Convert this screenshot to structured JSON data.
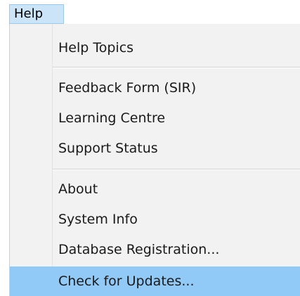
{
  "menubar": {
    "help_label": "Help"
  },
  "menu": {
    "items": [
      {
        "label": "Help Topics"
      },
      {
        "label": "Feedback Form (SIR)"
      },
      {
        "label": "Learning Centre"
      },
      {
        "label": "Support Status"
      },
      {
        "label": "About"
      },
      {
        "label": "System Info"
      },
      {
        "label": "Database Registration..."
      },
      {
        "label": "Check for Updates..."
      }
    ],
    "highlight_color": "#91c9f7"
  }
}
